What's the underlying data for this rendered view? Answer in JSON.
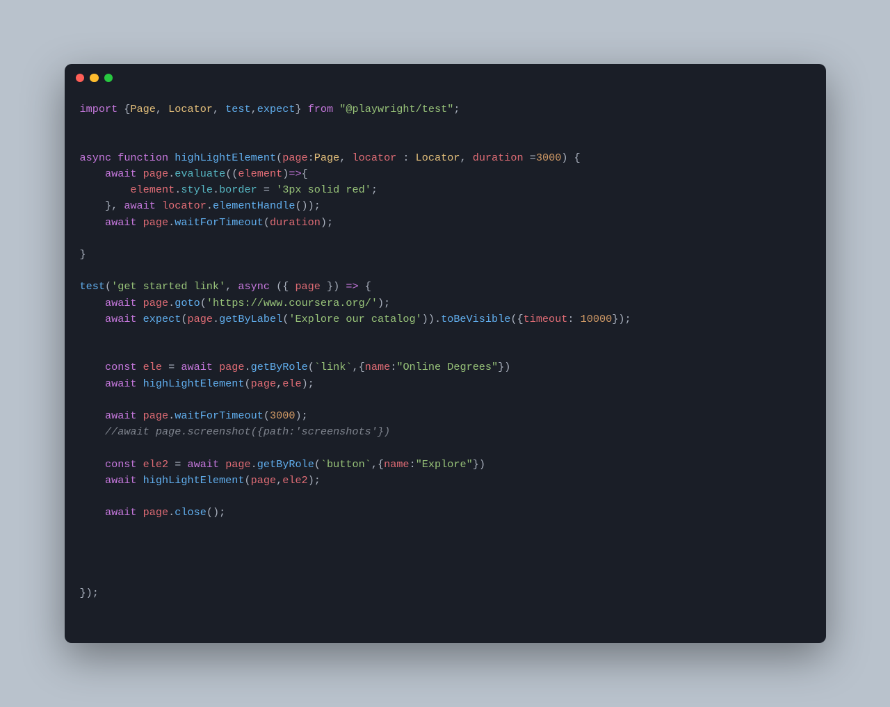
{
  "code": {
    "line1": {
      "import": "import",
      "lbrace": " {",
      "Page": "Page",
      "c1": ", ",
      "Locator": "Locator",
      "c2": ", ",
      "test": "test",
      "c3": ",",
      "expect": "expect",
      "rbrace": "} ",
      "from": "from",
      "sp": " ",
      "str": "\"@playwright/test\"",
      "semi": ";"
    },
    "line3": {
      "async": "async",
      "sp1": " ",
      "function": "function",
      "sp2": " ",
      "fname": "highLightElement",
      "lp": "(",
      "p1": "page",
      "colon1": ":",
      "t1": "Page",
      "c1": ", ",
      "p2": "locator",
      "sp3": " : ",
      "t2": "Locator",
      "c2": ", ",
      "p3": "duration",
      "eq": " =",
      "num": "3000",
      "rp": ") {"
    },
    "line4": {
      "indent": "    ",
      "await": "await",
      "sp": " ",
      "page": "page",
      "dot": ".",
      "eval": "evaluate",
      "lp": "((",
      "elem": "element",
      "rp": ")",
      "arrow": "=>",
      "lb": "{"
    },
    "line5": {
      "indent": "        ",
      "elem": "element",
      "dot1": ".",
      "style": "style",
      "dot2": ".",
      "border": "border",
      "eq": " = ",
      "str": "'3px solid red'",
      "semi": ";"
    },
    "line6": {
      "indent": "    }, ",
      "await": "await",
      "sp": " ",
      "loc": "locator",
      "dot": ".",
      "eh": "elementHandle",
      "pp": "());"
    },
    "line7": {
      "indent": "    ",
      "await": "await",
      "sp": " ",
      "page": "page",
      "dot": ".",
      "wft": "waitForTimeout",
      "lp": "(",
      "dur": "duration",
      "rp": ");"
    },
    "line9": {
      "brace": "}"
    },
    "line11": {
      "test": "test",
      "lp": "(",
      "str": "'get started link'",
      "c": ", ",
      "async": "async",
      "sp": " ({ ",
      "page": "page",
      "rp": " }) ",
      "arrow": "=>",
      "lb": " {"
    },
    "line12": {
      "indent": "    ",
      "await": "await",
      "sp": " ",
      "page": "page",
      "dot": ".",
      "goto": "goto",
      "lp": "(",
      "str": "'https://www.coursera.org/'",
      "rp": ");"
    },
    "line13": {
      "indent": "    ",
      "await": "await",
      "sp": " ",
      "expect": "expect",
      "lp": "(",
      "page": "page",
      "dot": ".",
      "gbl": "getByLabel",
      "lp2": "(",
      "str": "'Explore our catalog'",
      "rp2": ")).",
      "tbv": "toBeVisible",
      "lp3": "({",
      "to": "timeout",
      "colon": ": ",
      "num": "10000",
      "rp3": "});"
    },
    "line16": {
      "indent": "    ",
      "const": "const",
      "sp": " ",
      "ele": "ele",
      "eq": " = ",
      "await": "await",
      "sp2": " ",
      "page": "page",
      "dot": ".",
      "gbr": "getByRole",
      "lp": "(",
      "bt": "`link`",
      "c": ",{",
      "name": "name",
      "colon": ":",
      "str": "\"Online Degrees\"",
      "rp": "})"
    },
    "line17": {
      "indent": "    ",
      "await": "await",
      "sp": " ",
      "fn": "highLightElement",
      "lp": "(",
      "page": "page",
      "c": ",",
      "ele": "ele",
      "rp": ");"
    },
    "line19": {
      "indent": "    ",
      "await": "await",
      "sp": " ",
      "page": "page",
      "dot": ".",
      "wft": "waitForTimeout",
      "lp": "(",
      "num": "3000",
      "rp": ");"
    },
    "line20": {
      "indent": "    ",
      "comment": "//await page.screenshot({path:'screenshots'})"
    },
    "line22": {
      "indent": "    ",
      "const": "const",
      "sp": " ",
      "ele2": "ele2",
      "eq": " = ",
      "await": "await",
      "sp2": " ",
      "page": "page",
      "dot": ".",
      "gbr": "getByRole",
      "lp": "(",
      "bt": "`button`",
      "c": ",{",
      "name": "name",
      "colon": ":",
      "str": "\"Explore\"",
      "rp": "})"
    },
    "line23": {
      "indent": "    ",
      "await": "await",
      "sp": " ",
      "fn": "highLightElement",
      "lp": "(",
      "page": "page",
      "c": ",",
      "ele2": "ele2",
      "rp": ");"
    },
    "line25": {
      "indent": "    ",
      "await": "await",
      "sp": " ",
      "page": "page",
      "dot": ".",
      "close": "close",
      "pp": "();"
    },
    "line31": {
      "end": "});"
    }
  }
}
